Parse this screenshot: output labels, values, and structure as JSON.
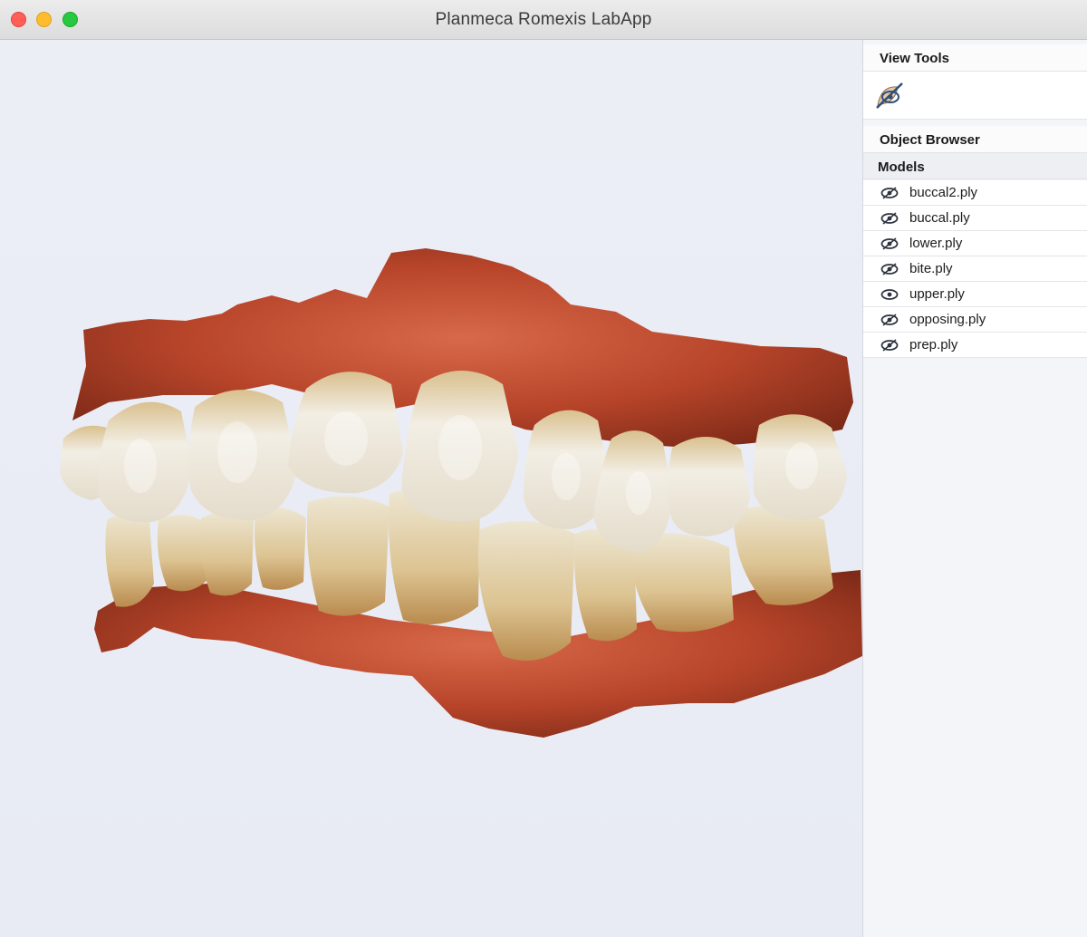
{
  "window": {
    "title": "Planmeca Romexis LabApp"
  },
  "sidebar": {
    "view_tools_header": "View Tools",
    "view_tools": [
      {
        "icon": "visibility-brush-icon"
      }
    ],
    "object_browser_header": "Object Browser",
    "models_header": "Models",
    "models": [
      {
        "name": "buccal2.ply",
        "icon": "eye-visibility-icon"
      },
      {
        "name": "buccal.ply",
        "icon": "eye-visibility-icon"
      },
      {
        "name": "lower.ply",
        "icon": "eye-visibility-icon"
      },
      {
        "name": "bite.ply",
        "icon": "eye-visibility-icon"
      },
      {
        "name": "upper.ply",
        "icon": "eye-visibility-icon"
      },
      {
        "name": "opposing.ply",
        "icon": "eye-visibility-icon"
      },
      {
        "name": "prep.ply",
        "icon": "eye-visibility-icon"
      }
    ]
  },
  "viewport": {
    "content": "3d-dental-scan-model"
  },
  "colors": {
    "gum": "#b8452a",
    "gum_dark": "#7e2a18",
    "tooth": "#ece6d6",
    "tooth_shadow": "#c9a871",
    "close": "#ff5f57",
    "minimize": "#febc2e",
    "maximize": "#28c840"
  }
}
